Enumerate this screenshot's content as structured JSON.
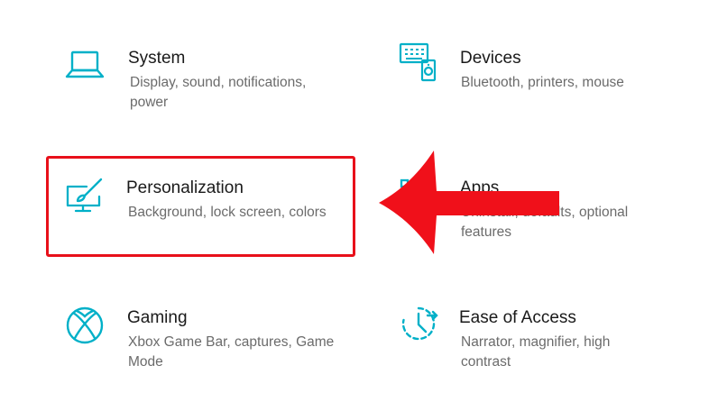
{
  "colors": {
    "accent": "#00b0c8",
    "highlight": "#e8101a",
    "title": "#1a1a1a",
    "description": "#6b6b6b"
  },
  "categories": [
    {
      "id": "system",
      "title": "System",
      "description": "Display, sound, notifications, power",
      "icon": "laptop-icon"
    },
    {
      "id": "devices",
      "title": "Devices",
      "description": "Bluetooth, printers, mouse",
      "icon": "keyboard-speaker-icon"
    },
    {
      "id": "personalization",
      "title": "Personalization",
      "description": "Background, lock screen, colors",
      "icon": "paintbrush-monitor-icon"
    },
    {
      "id": "apps",
      "title": "Apps",
      "description": "Uninstall, defaults, optional features",
      "icon": "apps-list-icon"
    },
    {
      "id": "gaming",
      "title": "Gaming",
      "description": "Xbox Game Bar, captures, Game Mode",
      "icon": "xbox-icon"
    },
    {
      "id": "ease-of-access",
      "title": "Ease of Access",
      "description": "Narrator, magnifier, high contrast",
      "icon": "ease-of-access-icon"
    }
  ]
}
